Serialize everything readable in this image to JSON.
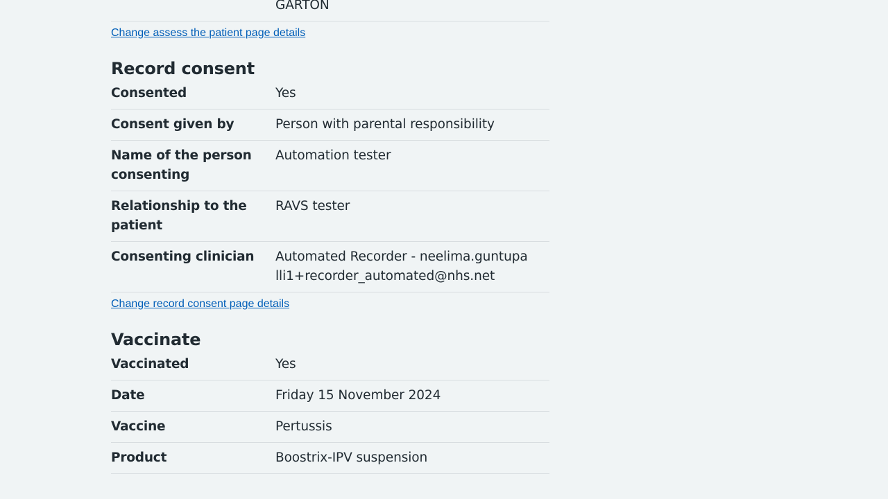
{
  "assess_section": {
    "rows": [
      {
        "key": "",
        "value": "GARTON"
      }
    ],
    "change_link": "Change assess the patient page details"
  },
  "record_consent": {
    "heading": "Record consent",
    "rows": [
      {
        "key": "Consented",
        "value": "Yes"
      },
      {
        "key": "Consent given by",
        "value": "Person with parental responsibility"
      },
      {
        "key": "Name of the person consenting",
        "value": "Automation tester"
      },
      {
        "key": "Relationship to the patient",
        "value": "RAVS tester"
      },
      {
        "key": "Consenting clinician",
        "value": "Automated Recorder - neelima.guntupalli1+recorder_automated@nhs.net"
      }
    ],
    "change_link": "Change record consent page details"
  },
  "vaccinate": {
    "heading": "Vaccinate",
    "rows": [
      {
        "key": "Vaccinated",
        "value": "Yes"
      },
      {
        "key": "Date",
        "value": "Friday 15 November 2024"
      },
      {
        "key": "Vaccine",
        "value": "Pertussis"
      },
      {
        "key": "Product",
        "value": "Boostrix-IPV suspension"
      }
    ]
  }
}
